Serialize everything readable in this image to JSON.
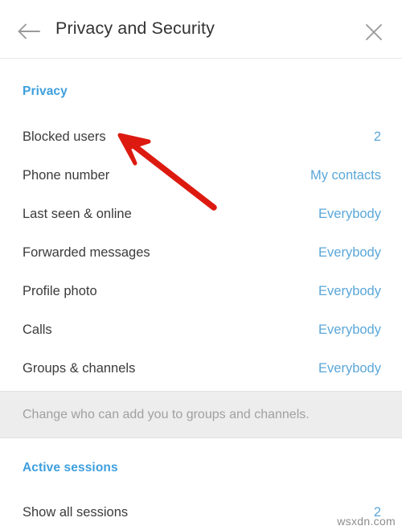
{
  "header": {
    "title": "Privacy and Security",
    "back_icon": "arrow-left-icon",
    "close_icon": "close-icon"
  },
  "privacy": {
    "section_title": "Privacy",
    "rows": [
      {
        "label": "Blocked users",
        "value": "2"
      },
      {
        "label": "Phone number",
        "value": "My contacts"
      },
      {
        "label": "Last seen & online",
        "value": "Everybody"
      },
      {
        "label": "Forwarded messages",
        "value": "Everybody"
      },
      {
        "label": "Profile photo",
        "value": "Everybody"
      },
      {
        "label": "Calls",
        "value": "Everybody"
      },
      {
        "label": "Groups & channels",
        "value": "Everybody"
      }
    ],
    "note": "Change who can add you to groups and channels."
  },
  "active_sessions": {
    "section_title": "Active sessions",
    "rows": [
      {
        "label": "Show all sessions",
        "value": "2"
      }
    ]
  },
  "annotation": {
    "type": "arrow",
    "color": "#dd1a10",
    "points_to": "Blocked users"
  },
  "watermark": {
    "text": "wsxdn.com"
  },
  "colors": {
    "accent_blue": "#5aa7d8",
    "section_blue": "#3e9fdd",
    "label_gray": "#3b3b3b",
    "note_gray": "#a0a0a0",
    "band_bg": "#ededed",
    "annotation_red": "#dd1a10"
  }
}
